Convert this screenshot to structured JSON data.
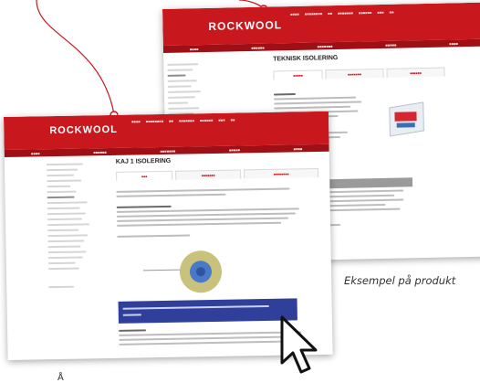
{
  "colors": {
    "accent": "#c8181e",
    "dark_red": "#9f1016",
    "blue_bar": "#2f3f9a"
  },
  "back_screenshot": {
    "logo": "ROCKWOOL",
    "page_title": "TEKNISK ISOLERING"
  },
  "front_screenshot": {
    "logo": "ROCKWOOL",
    "page_title": "KAJ 1 ISOLERING"
  },
  "caption": "Eksempel på produkt",
  "bottom_fragment": "Å",
  "icons": [
    "mouse-pointer-icon"
  ]
}
